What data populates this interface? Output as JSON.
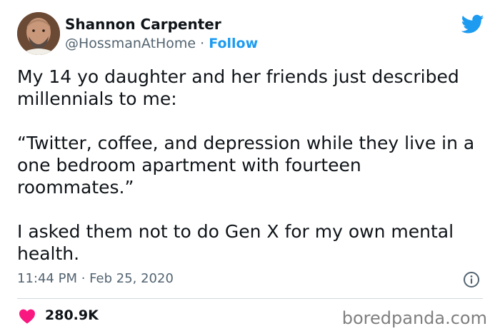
{
  "tweet": {
    "author_name": "Shannon Carpenter",
    "handle": "@HossmanAtHome",
    "separator": " · ",
    "follow_label": "Follow",
    "body": "My 14 yo daughter and her friends just described\nmillennials to me:\n\n“Twitter, coffee, and depression while they live in a\none bedroom apartment with fourteen\nroommates.”\n\nI asked them not to do Gen X for my own mental\nhealth.",
    "timestamp": "11:44 PM · Feb 25, 2020",
    "likes": "280.9K"
  },
  "watermark": "boredpanda.com",
  "icons": {
    "brand": "twitter-bird-icon",
    "info": "info-icon",
    "like": "heart-icon"
  },
  "colors": {
    "brand": "#1d9bf0",
    "heart": "#f91880",
    "secondary_text": "#536471"
  }
}
